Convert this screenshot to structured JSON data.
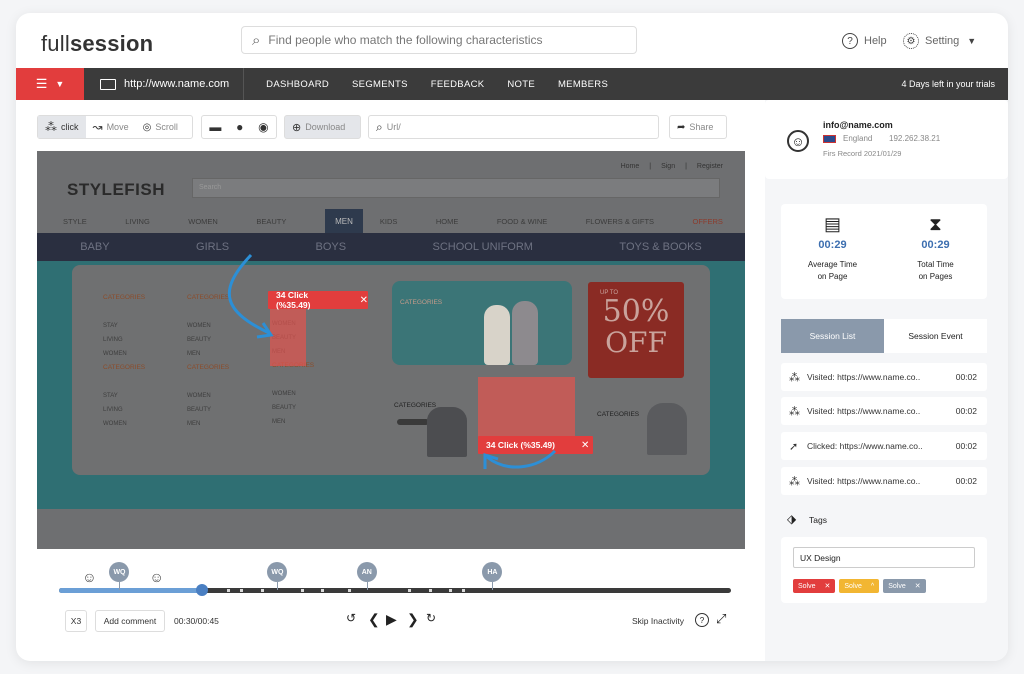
{
  "brand": {
    "logo_a": "full",
    "logo_b": "session"
  },
  "search": {
    "placeholder": "Find people who match the following characteristics"
  },
  "header": {
    "help": "Help",
    "setting": "Setting"
  },
  "navbar": {
    "url": "http://www.name.com",
    "links": [
      "DASHBOARD",
      "SEGMENTS",
      "FEEDBACK",
      "NOTE",
      "MEMBERS"
    ],
    "trial": "4 Days left in your trials"
  },
  "toolbar": {
    "click": "click",
    "move": "Move",
    "scroll": "Scroll",
    "download": "Download",
    "url_placeholder": "Url/",
    "share": "Share"
  },
  "stage": {
    "brand": "STYLEFISH",
    "search": "Search",
    "top_links": [
      "Home",
      "|",
      "Sign",
      "|",
      "Register"
    ],
    "categories": [
      "STYLE",
      "LIVING",
      "WOMEN",
      "BEAUTY",
      "MEN",
      "KIDS",
      "HOME",
      "FOOD & WINE",
      "FLOWERS & GIFTS",
      "OFFERS"
    ],
    "sub_nav": [
      "BABY",
      "GIRLS",
      "BOYS",
      "SCHOOL UNIFORM",
      "TOYS & BOOKS"
    ],
    "cat_label": "CATEGORIES",
    "col1": [
      "STAY",
      "LIVING",
      "WOMEN"
    ],
    "col2": [
      "WOMEN",
      "BEAUTY",
      "MEN"
    ],
    "col3": [
      "WOMEN",
      "BEAUTY",
      "MEN"
    ],
    "promo_up_to": "UP TO",
    "promo_pct": "50%",
    "promo_off": "OFF",
    "heat1": "34 Click (%35.49)",
    "heat2": "34 Click (%35.49)"
  },
  "player": {
    "speed": "X3",
    "add_comment": "Add comment",
    "time": "00:30/00:45",
    "skip": "Skip Inactivity",
    "progress": 0.213,
    "markers": [
      {
        "kind": "smile",
        "at": 0.045
      },
      {
        "kind": "avatar",
        "label": "WQ",
        "at": 0.09
      },
      {
        "kind": "smile",
        "at": 0.145
      },
      {
        "kind": "avatar",
        "label": "WQ",
        "at": 0.325
      },
      {
        "kind": "avatar",
        "label": "AN",
        "at": 0.458
      },
      {
        "kind": "avatar",
        "label": "HA",
        "at": 0.645
      }
    ]
  },
  "user": {
    "email": "info@name.com",
    "country": "England",
    "ip": "192.262.38.21",
    "first_record": "Firs Record 2021/01/29"
  },
  "stats": {
    "avg_time": "00:29",
    "avg_label_1": "Average Time",
    "avg_label_2": "on Page",
    "total_time": "00:29",
    "total_label_1": "Total Time",
    "total_label_2": "on Pages"
  },
  "tabs": {
    "list": "Session List",
    "event": "Session Event"
  },
  "sessions": [
    {
      "icon": "click",
      "text": "Visited: https://www.name.co..",
      "time": "00:02"
    },
    {
      "icon": "click",
      "text": "Visited: https://www.name.co..",
      "time": "00:02"
    },
    {
      "icon": "pointer",
      "text": "Clicked: https://www.name.co..",
      "time": "00:02"
    },
    {
      "icon": "click",
      "text": "Visited: https://www.name.co..",
      "time": "00:02"
    }
  ],
  "tags": {
    "title": "Tags",
    "input": "UX Design",
    "items": [
      {
        "label": "Solve",
        "color": "#e23d3d",
        "x": "✕"
      },
      {
        "label": "Solve",
        "color": "#f2b632",
        "x": "^"
      },
      {
        "label": "Solve",
        "color": "#8a99ab",
        "x": "✕"
      }
    ]
  }
}
